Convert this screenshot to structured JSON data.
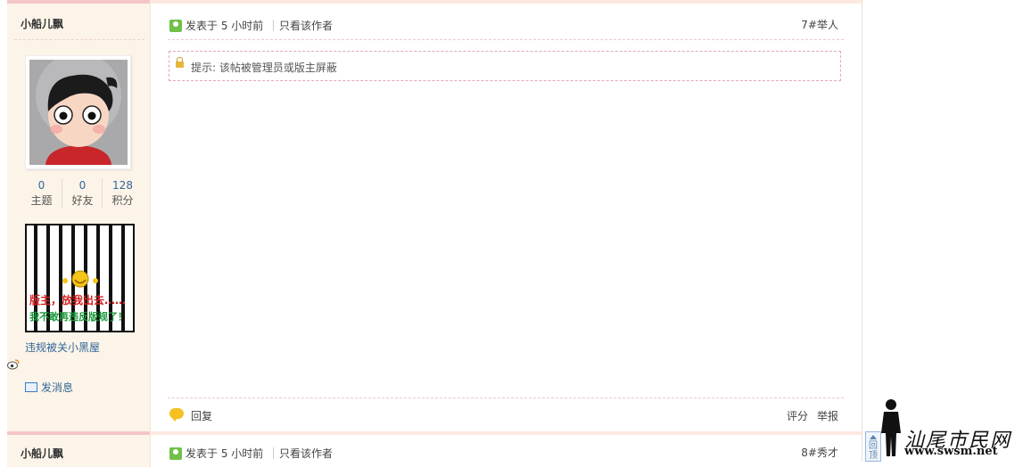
{
  "post1": {
    "username": "小船儿飘",
    "stats": [
      {
        "value": "0",
        "label": "主题"
      },
      {
        "value": "0",
        "label": "好友"
      },
      {
        "value": "128",
        "label": "积分"
      }
    ],
    "medal_lines": [
      "版主，放我出去……",
      "我不敢再违反版规了！"
    ],
    "medal_caption": "违规被关小黑屋",
    "send_message": "发消息",
    "post_time": "发表于 5 小时前",
    "only_author": "只看该作者",
    "floor": "7#举人",
    "notice": "提示: 该帖被管理员或版主屏蔽",
    "reply": "回复",
    "rate": "评分",
    "report": "举报"
  },
  "post2": {
    "username": "小船儿飘",
    "post_time": "发表于 5 小时前",
    "only_author": "只看该作者",
    "floor": "8#秀才"
  },
  "back_to_top": "回顶",
  "site_logo": {
    "text": "汕尾市民网",
    "url": "www.swsm.net"
  }
}
